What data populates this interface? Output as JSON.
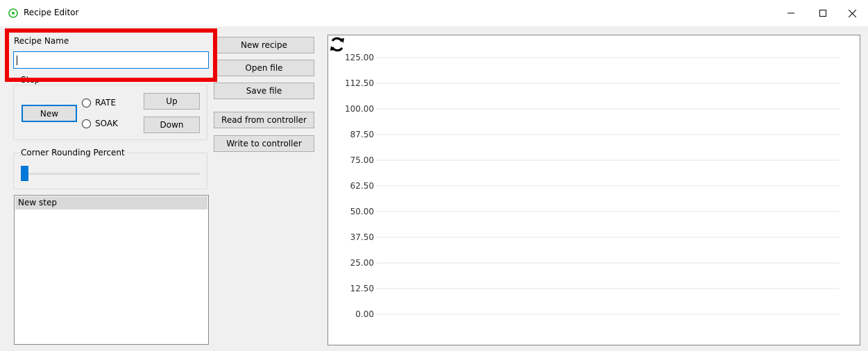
{
  "window": {
    "title": "Recipe Editor",
    "app_icon": "recipe-app-icon",
    "controls": [
      "minimize-icon",
      "maximize-icon",
      "close-icon"
    ]
  },
  "recipe_name": {
    "label": "Recipe Name",
    "value": ""
  },
  "step_group": {
    "title": "Step",
    "new_label": "New",
    "radio_rate_label": "RATE",
    "radio_soak_label": "SOAK",
    "up_label": "Up",
    "down_label": "Down"
  },
  "corner_rounding": {
    "title": "Corner Rounding Percent",
    "value_percent": 0
  },
  "steps_list": {
    "items": [
      "New step"
    ]
  },
  "actions": {
    "new_recipe": "New recipe",
    "open_file": "Open file",
    "save_file": "Save file",
    "read_controller": "Read from controller",
    "write_controller": "Write to controller"
  },
  "chart_data": {
    "type": "line",
    "ylim": [
      0,
      125
    ],
    "yticks": [
      "125.00",
      "112.50",
      "100.00",
      "87.50",
      "75.00",
      "62.50",
      "50.00",
      "37.50",
      "25.00",
      "12.50",
      "0.00"
    ],
    "series": [],
    "grid": true,
    "refresh_icon": "refresh-icon"
  },
  "colors": {
    "accent": "#0078d7",
    "highlight": "#ef0000"
  }
}
